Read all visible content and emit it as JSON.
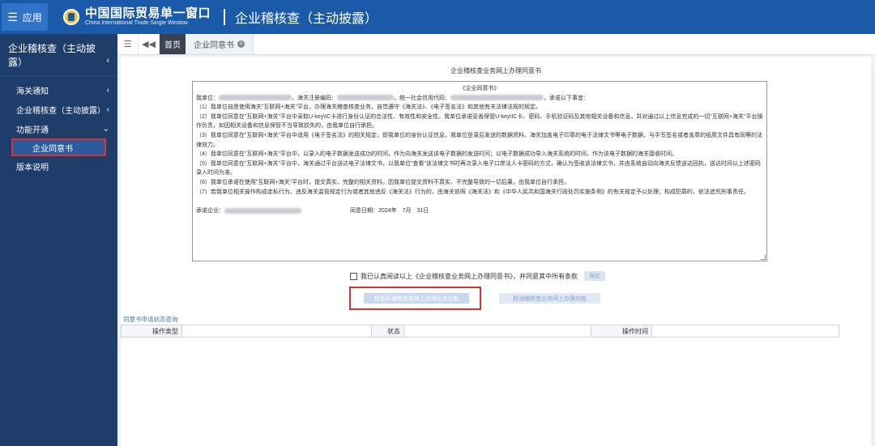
{
  "header": {
    "app_button": "应用",
    "logo_cn": "中国国际贸易单一窗口",
    "logo_en": "China International Trade Single Window",
    "title": "企业稽核查（主动披露）"
  },
  "sidebar": {
    "title": "企业稽核查（主动披露）",
    "items": [
      {
        "label": "海关通知"
      },
      {
        "label": "企业稽核查（主动披露）"
      },
      {
        "label": "功能开通"
      },
      {
        "label": "企业同意书"
      },
      {
        "label": "版本说明"
      }
    ]
  },
  "tabs": {
    "home": "首页",
    "active": "企业同意书"
  },
  "document": {
    "heading": "企业稽核查业务网上办理同意书",
    "inner_title": "《企业同意书》",
    "line_intro_1": "我单位：",
    "line_intro_2": "，海关注册编码：",
    "line_intro_3": "，统一社会信用代码：",
    "line_intro_4": "，承诺以下事宜：",
    "p1": "（1）我单位自愿使用海关\"互联网+海关\"平台，办理海关稽查核查业务，自觉遵守《海关法》、《电子签名法》和其他有关法律法规的规定。",
    "p2": "（2）我单位同意在\"互联网+海关\"平台中采取U-key\\IC卡进行身份认证的合法性、有效性和安全性。我单位承诺妥善保管U-key\\IC卡、密码、手机验证码及其他相关设备和信息，并对通过以上信息完成的一切\"互联网+海关\"平台操作负责，如因相关设备和信息保管不当导致损失的，由我单位自行承担。",
    "p3": "（3）我单位同意在\"互联网+海关\"平台中适用《电子签名法》的相关规定，即我单位的身份认证信息、我单位登录后发送的数据资料、海关加盖电子印章的电子法律文书等电子数据，与手写签名或者盖章的纸质文件具有同等的法律效力。",
    "p4": "（4）我单位同意在\"互联网+海关\"平台中，以录入的电子数据发送成功的时间，作为向海关发送该电子数据的发送时间；以电子数据成功导入海关系统的时间，作为该电子数据的海关接收时间。",
    "p5": "（5）我单位同意在\"互联网+海关\"平台中，海关通过平台送达电子法律文书，以我单位\"查看\"该法律文书时再次录入电子口岸法人卡密码的方式，确认为签收该法律文书，并由系统自动向海关反馈送达回执，送达时间以上述密码录入时间为准。",
    "p6": "（6）我单位承诺在使用\"互联网+海关\"平台时，提交真实、完整的相关资料。因我单位提交资料不真实、不完整导致的一切后果，由我单位自行承担。",
    "p7": "（7）若我单位相关操作构成走私行为、违反海关监管规定行为或者其他违反《海关法》行为的，由海关依照《海关法》和《中华人民共和国海关行政处罚实施条例》的有关规定予以处理；构成犯罪的，依法追究刑事责任。",
    "signer_label": "承诺企业：",
    "date_label": "同意日期：",
    "date_value": "2024年　7月　31日"
  },
  "agreement": {
    "checkbox_label": "我已认真阅读以上《企业稽核查业务网上办理同意书》，并同意其中所有条款",
    "confirm_pill": "确定"
  },
  "buttons": {
    "open": "我要开通稽核查网上办理业务功能",
    "cancel": "取消稽核查业务网上办理功能"
  },
  "status_query": {
    "label": "同意书申请状态查询",
    "columns": [
      "操作类型",
      "状态",
      "操作时间"
    ]
  },
  "colors": {
    "header_bg": "#1b5aa8",
    "sidebar_bg": "#1f3d6b",
    "highlight": "#e03030"
  }
}
